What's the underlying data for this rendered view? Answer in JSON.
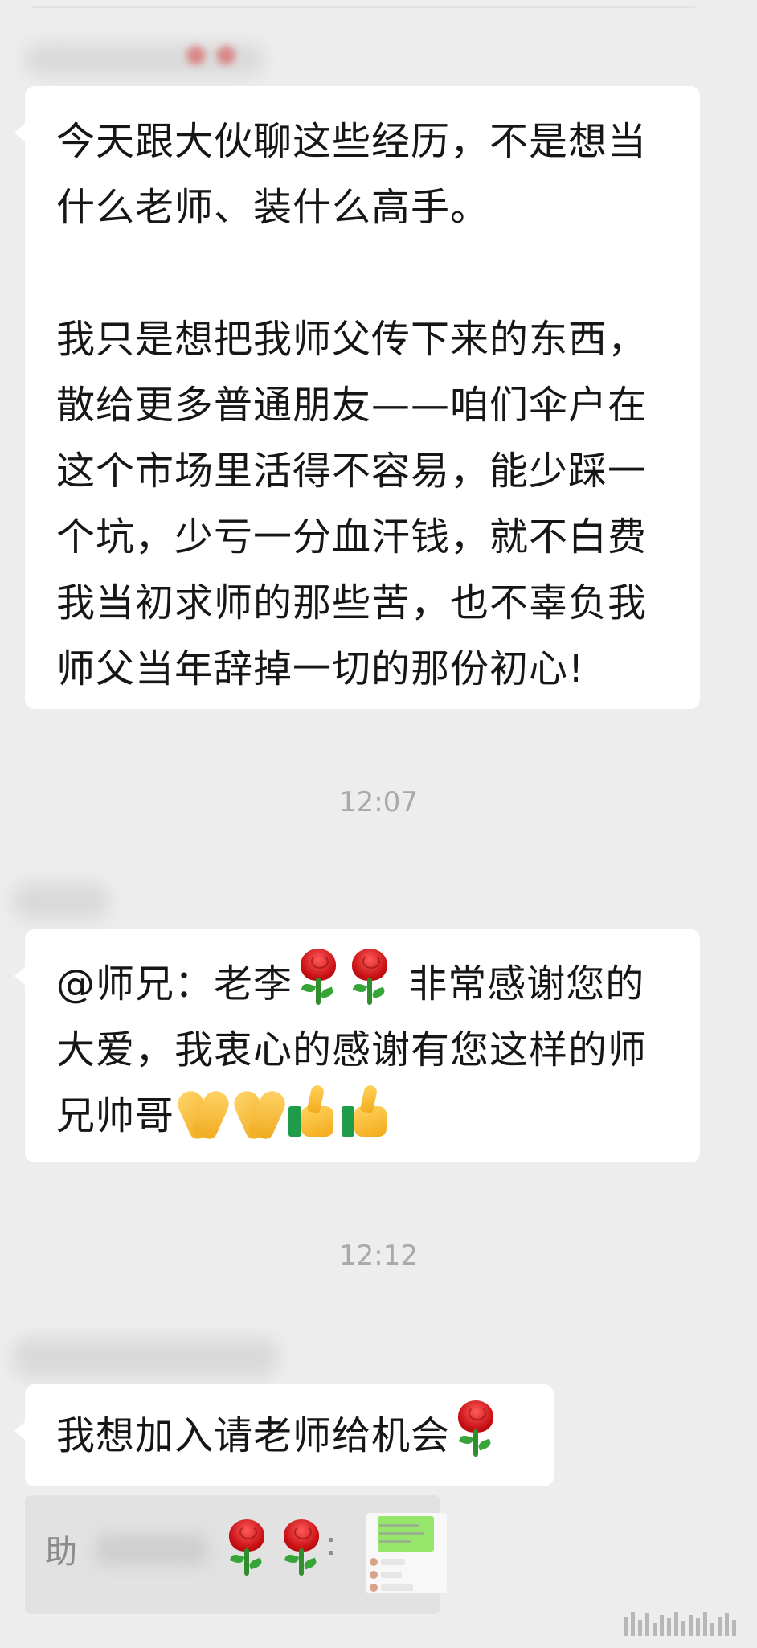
{
  "messages": [
    {
      "paragraph1": "今天跟大伙聊这些经历，不是想当什么老师、装什么高手。",
      "paragraph2": "我只是想把我师父传下来的东西，散给更多普通朋友——咱们伞户在这个市场里活得不容易，能少踩一个坑，少亏一分血汗钱，就不白费我当初求师的那些苦，也不辜负我师父当年辞掉一切的那份初心!"
    },
    {
      "time": "12:07",
      "part1": "@师兄：老李",
      "part2": "非常感谢您的大爱，我衷心的感谢有您这样的师兄帅哥"
    },
    {
      "time": "12:12",
      "text": "我想加入请老师给机会"
    }
  ],
  "quote": {
    "prefix": "助",
    "separator": ":"
  },
  "icons": {
    "rose": "rose-icon",
    "clap": "praying-hands-icon",
    "thumbs": "thumbs-up-icon"
  },
  "colors": {
    "background": "#ededed",
    "bubble": "#ffffff",
    "quote_bg": "#e2e2e2",
    "timestamp": "#a9a9a9"
  }
}
